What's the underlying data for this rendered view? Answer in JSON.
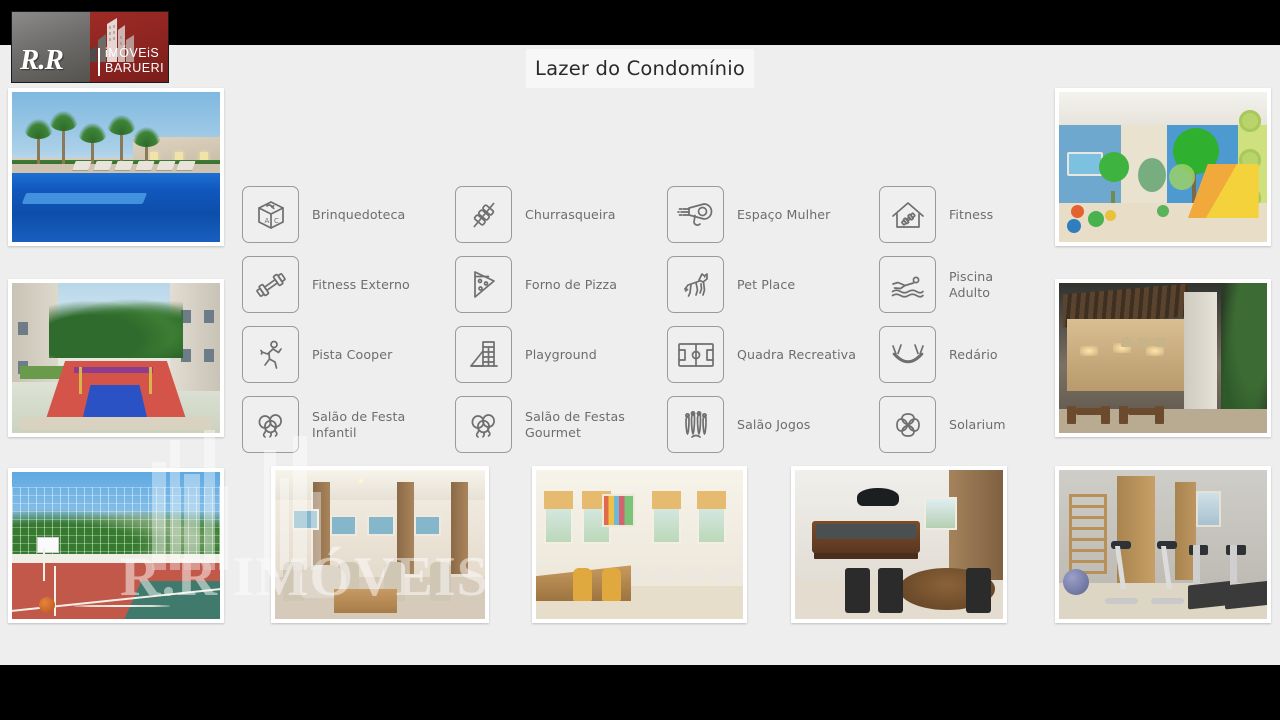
{
  "logo": {
    "mark": "R.R",
    "line1": "iMÓVEiS",
    "line2": "BARUERI",
    "name": "R.R Imóveis Barueri"
  },
  "header": {
    "title": "Lazer do Condomínio"
  },
  "watermark": {
    "text": "R.R IMÓVEIS"
  },
  "amenities": [
    {
      "label": "Brinquedoteca",
      "icon": "toy-block-icon",
      "col": 0,
      "row": 0
    },
    {
      "label": "Fitness Externo",
      "icon": "dumbbell-icon",
      "col": 0,
      "row": 1
    },
    {
      "label": "Pista Cooper",
      "icon": "runner-icon",
      "col": 0,
      "row": 2
    },
    {
      "label": "Salão de Festa\nInfantil",
      "icon": "balloons-icon",
      "col": 0,
      "row": 3
    },
    {
      "label": "Churrasqueira",
      "icon": "skewer-icon",
      "col": 1,
      "row": 0
    },
    {
      "label": "Forno de Pizza",
      "icon": "pizza-slice-icon",
      "col": 1,
      "row": 1
    },
    {
      "label": "Playground",
      "icon": "playground-slide-icon",
      "col": 1,
      "row": 2
    },
    {
      "label": "Salão de Festas\nGourmet",
      "icon": "balloons-icon",
      "col": 1,
      "row": 3
    },
    {
      "label": "Espaço Mulher",
      "icon": "hairdryer-icon",
      "col": 2,
      "row": 0
    },
    {
      "label": "Pet Place",
      "icon": "dog-icon",
      "col": 2,
      "row": 1
    },
    {
      "label": "Quadra Recreativa",
      "icon": "sports-field-icon",
      "col": 2,
      "row": 2
    },
    {
      "label": "Salão Jogos",
      "icon": "bowling-pins-icon",
      "col": 2,
      "row": 3
    },
    {
      "label": "Fitness",
      "icon": "home-dumbbell-icon",
      "col": 3,
      "row": 0
    },
    {
      "label": "Piscina Adulto",
      "icon": "swimmer-icon",
      "col": 3,
      "row": 1
    },
    {
      "label": "Redário",
      "icon": "hammock-icon",
      "col": 3,
      "row": 2
    },
    {
      "label": "Solarium",
      "icon": "sun-pinwheel-icon",
      "col": 3,
      "row": 3
    }
  ],
  "photos": [
    {
      "name": "photo-pool",
      "caption": "Piscina adulto com espreguiçadeiras e palmeiras"
    },
    {
      "name": "photo-playground",
      "caption": "Área de playground e quadra colorida"
    },
    {
      "name": "photo-kids-room",
      "caption": "Brinquedoteca infantil"
    },
    {
      "name": "photo-bbq",
      "caption": "Espaço churrasqueira gourmet"
    },
    {
      "name": "photo-court",
      "caption": "Quadra recreativa com cesta de basquete"
    },
    {
      "name": "photo-lounge",
      "caption": "Salão de festas lounge"
    },
    {
      "name": "photo-gourmet",
      "caption": "Salão de festas gourmet com bar"
    },
    {
      "name": "photo-games",
      "caption": "Salão de jogos com mesa de sinuca"
    },
    {
      "name": "photo-fitness",
      "caption": "Academia com esteiras e bicicletas"
    }
  ],
  "colors": {
    "slide_background": "#eeeeee",
    "letterbox": "#000000",
    "logo_red": "#8c2420",
    "logo_grey": "#6e6c6a",
    "icon_border": "#9a9a9a",
    "label_text": "#6d6d6d",
    "title_text": "#2a2a2a",
    "title_background": "#f7f7f7"
  }
}
